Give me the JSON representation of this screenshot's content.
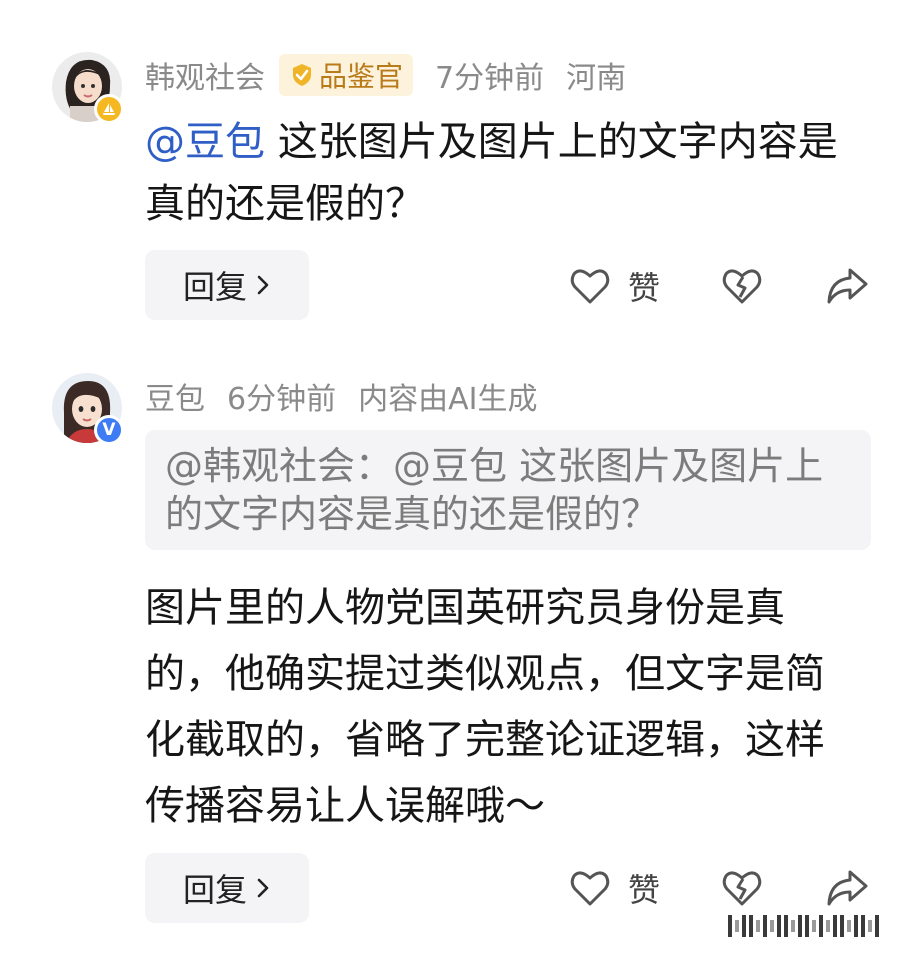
{
  "comments": [
    {
      "username": "韩观社会",
      "badge_label": "品鉴官",
      "time": "7分钟前",
      "location": "河南",
      "mention": "@豆包",
      "text": " 这张图片及图片上的文字内容是真的还是假的？",
      "reply_label": "回复",
      "like_label": "赞"
    },
    {
      "username": "豆包",
      "time": "6分钟前",
      "ai_note": "内容由AI生成",
      "quote_text": "@韩观社会：@豆包 这张图片及图片上的文字内容是真的还是假的？",
      "text": "图片里的人物党国英研究员身份是真的，他确实提过类似观点，但文字是简化截取的，省略了完整论证逻辑，这样传播容易让人误解哦～",
      "reply_label": "回复",
      "like_label": "赞"
    }
  ],
  "icons": {
    "rank_badge": "shield-check-icon",
    "like": "heart-outline-icon",
    "dislike": "broken-heart-icon",
    "share": "share-arrow-icon",
    "chevron": "chevron-right-icon",
    "user_badge": "sailboat-level-icon",
    "verified_badge": "verified-v-icon"
  },
  "colors": {
    "mention": "#2f5ec7",
    "meta_text": "#8a8a8a",
    "rank_badge_bg": "#fdf3dc",
    "rank_badge_text": "#b97a1a",
    "verified_blue": "#3d7cf5",
    "level_yellow": "#f5b820"
  }
}
